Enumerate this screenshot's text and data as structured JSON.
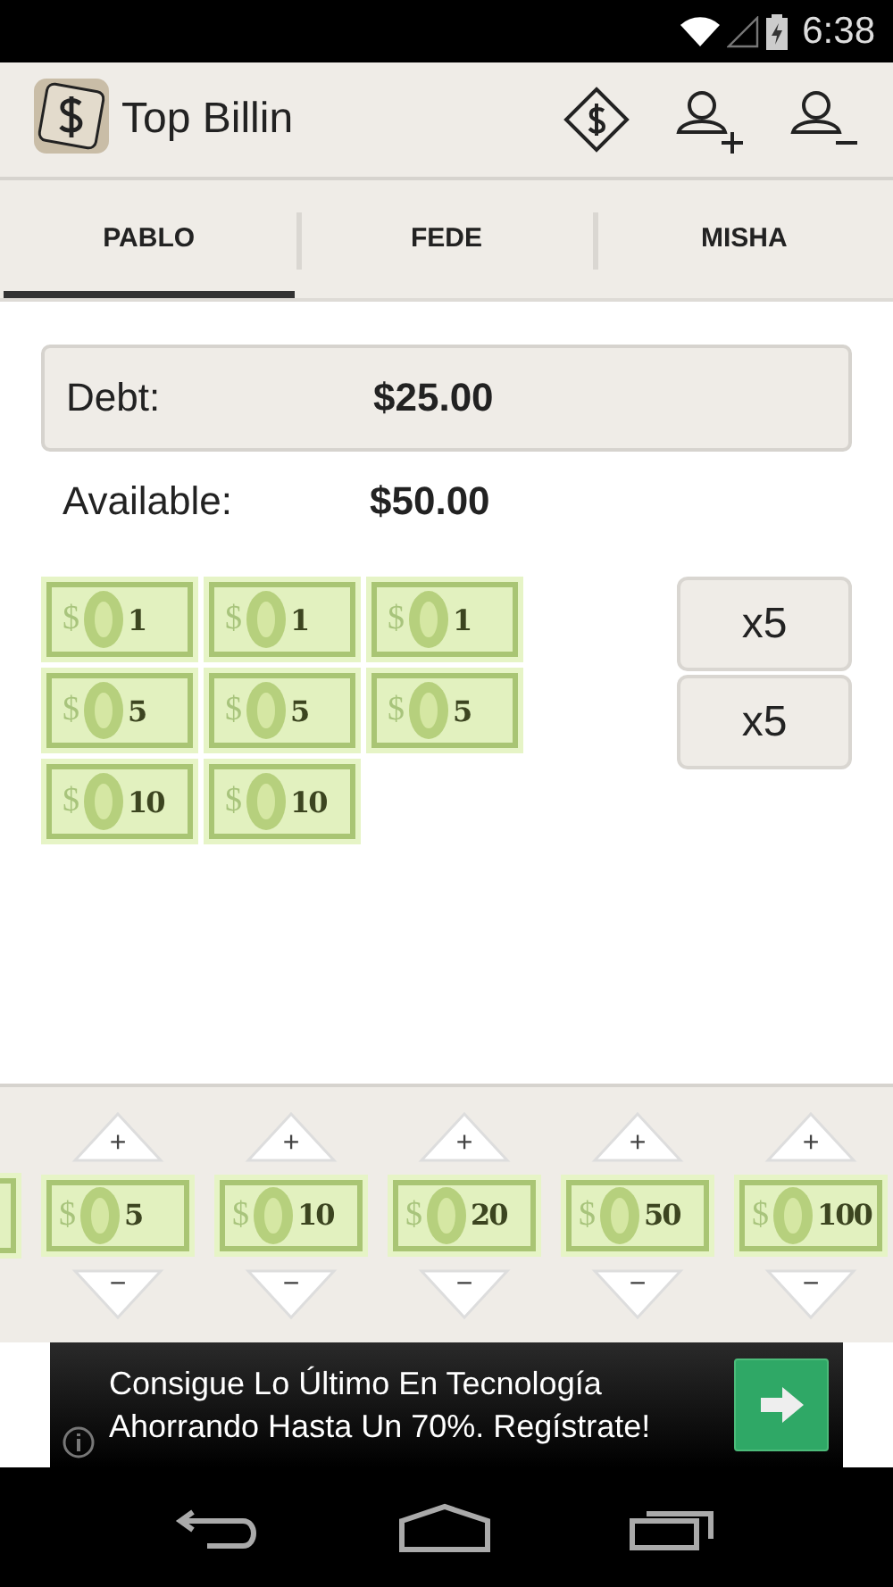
{
  "status_bar": {
    "time": "6:38"
  },
  "action_bar": {
    "title": "Top Billin"
  },
  "tabs": [
    {
      "label": "PABLO",
      "selected": true
    },
    {
      "label": "FEDE",
      "selected": false
    },
    {
      "label": "MISHA",
      "selected": false
    }
  ],
  "summary": [
    {
      "label": "Debt:",
      "value": "$25.00",
      "kind": "boxed"
    },
    {
      "label": "Available:",
      "value": "$50.00",
      "kind": "plain"
    }
  ],
  "wallet": {
    "rows": [
      [
        {
          "sign": "$",
          "value": "1"
        },
        {
          "sign": "$",
          "value": "1"
        },
        {
          "sign": "$",
          "value": "1"
        }
      ],
      [
        {
          "sign": "$",
          "value": "5"
        },
        {
          "sign": "$",
          "value": "5"
        },
        {
          "sign": "$",
          "value": "5"
        }
      ],
      [
        {
          "sign": "$",
          "value": "10"
        },
        {
          "sign": "$",
          "value": "10"
        }
      ]
    ],
    "multipliers": [
      "x5",
      "x5"
    ]
  },
  "denominations": [
    {
      "kind": "cut"
    },
    {
      "kind": "bill",
      "plus": "+",
      "sign": "$",
      "value": "5",
      "minus": "−"
    },
    {
      "kind": "bill",
      "plus": "+",
      "sign": "$",
      "value": "10",
      "minus": "−"
    },
    {
      "kind": "bill",
      "plus": "+",
      "sign": "$",
      "value": "20",
      "minus": "−"
    },
    {
      "kind": "bill",
      "plus": "+",
      "sign": "$",
      "value": "50",
      "minus": "−"
    },
    {
      "kind": "bill",
      "plus": "+",
      "sign": "$",
      "value": "100",
      "minus": "−"
    }
  ],
  "ad": {
    "text": "Consigue Lo Último En Tecnología Ahorrando Hasta Un 70%. Regístrate!"
  }
}
